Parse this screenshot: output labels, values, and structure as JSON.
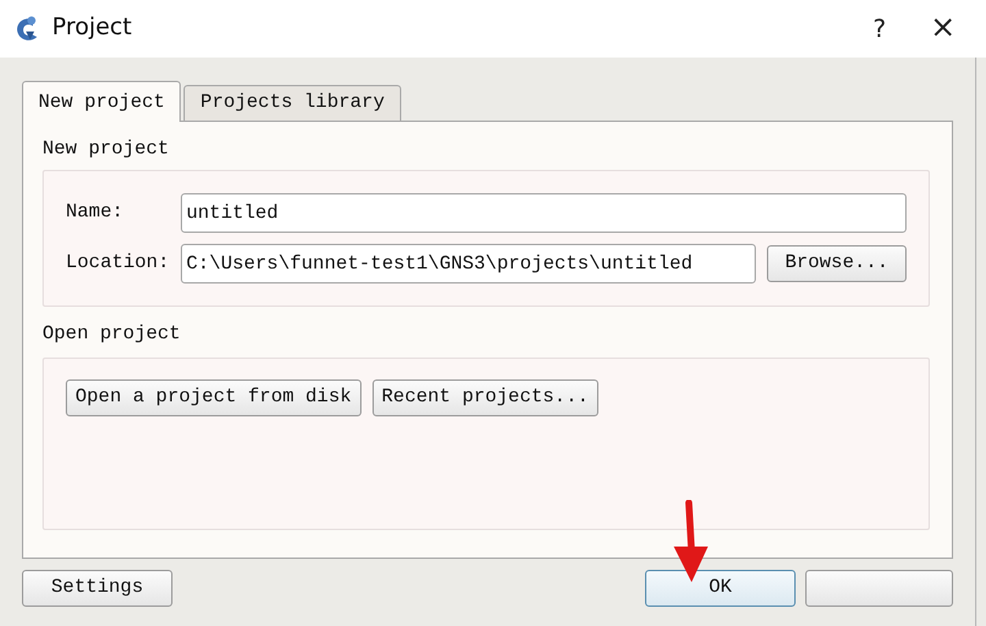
{
  "window": {
    "title": "Project",
    "help": "?",
    "close": "×"
  },
  "tabs": [
    {
      "label": "New project",
      "selected": true
    },
    {
      "label": "Projects library",
      "selected": false
    }
  ],
  "new_project": {
    "title": "New project",
    "name_label": "Name:",
    "name_value": "untitled",
    "location_label": "Location:",
    "location_value": "C:\\Users\\funnet-test1\\GNS3\\projects\\untitled",
    "browse": "Browse..."
  },
  "open_project": {
    "title": "Open project",
    "buttons": [
      "Open a project from disk",
      "Recent projects..."
    ]
  },
  "footer": {
    "settings": "Settings",
    "ok": "OK",
    "ok_selected": true
  }
}
